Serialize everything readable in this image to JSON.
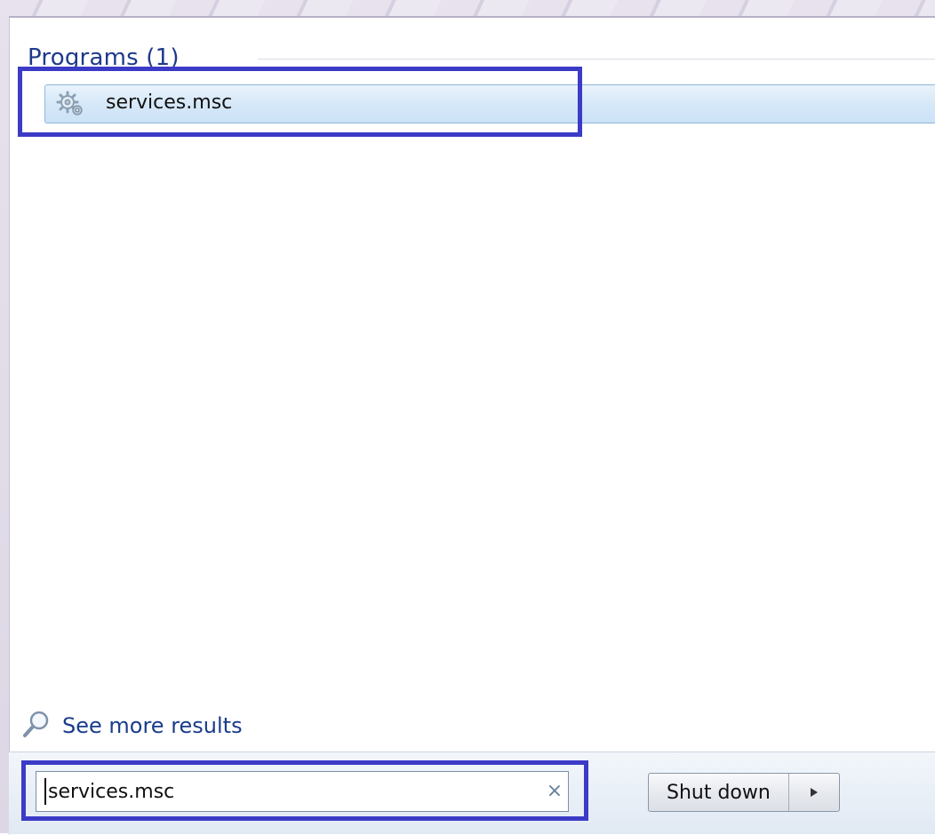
{
  "results": {
    "section_header": "Programs (1)",
    "items": [
      {
        "label": "services.msc",
        "icon": "services-gear-icon"
      }
    ]
  },
  "see_more": {
    "label": "See more results",
    "icon": "magnifier-icon"
  },
  "search": {
    "value": "services.msc",
    "clear_icon": "×"
  },
  "power": {
    "shutdown_label": "Shut down",
    "options_icon": "triangle-right-icon"
  },
  "colors": {
    "highlight_border": "#3b3bc7",
    "header_text": "#1e3a8a",
    "link_text": "#1a3c8b",
    "selected_row": "#d6e8f8"
  }
}
